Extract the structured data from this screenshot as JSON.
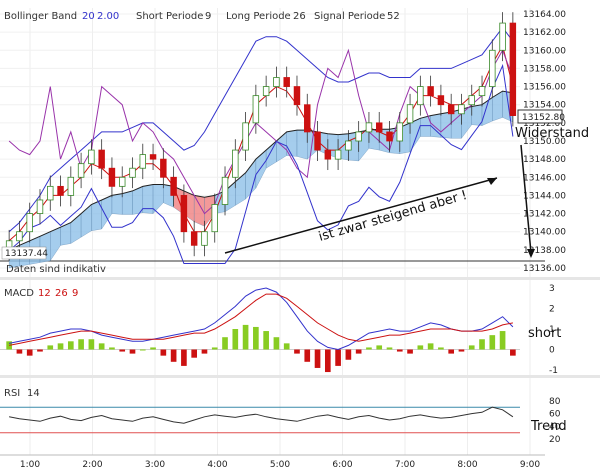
{
  "header": {
    "bb_label": "Bollinger Band",
    "bb_p1": "20",
    "bb_p2": "2.00",
    "short_label": "Short Periode",
    "short_val": "9",
    "long_label": "Long Periode",
    "long_val": "26",
    "signal_label": "Signal Periode",
    "signal_val": "52"
  },
  "price_axis": {
    "ticks": [
      "13164.00",
      "13162.00",
      "13160.00",
      "13158.00",
      "13156.00",
      "13154.00",
      "13152.00",
      "13150.00",
      "13148.00",
      "13146.00",
      "13144.00",
      "13142.00",
      "13140.00",
      "13138.00",
      "13136.00"
    ],
    "current_price": "13152.80",
    "left_price": "13137.44"
  },
  "info_text": "Daten sind indikativ",
  "macd": {
    "label": "MACD",
    "p1": "12",
    "p2": "26",
    "p3": "9",
    "ticks": [
      "3",
      "2",
      "1",
      "0",
      "-1"
    ]
  },
  "rsi": {
    "label": "RSI",
    "period": "14",
    "ticks": [
      "80",
      "60",
      "40",
      "20"
    ]
  },
  "time_ticks": [
    "1:00",
    "2:00",
    "3:00",
    "4:00",
    "5:00",
    "6:00",
    "7:00",
    "8:00",
    "9:00"
  ],
  "annotations": {
    "widerstand": "Widerstand",
    "steigend": "ist zwar steigend aber !",
    "short": "short",
    "trend": "Trend"
  },
  "colors": {
    "bull": "#3a8a2a",
    "bear": "#cc1111",
    "bollinger": "#3333cc",
    "purple": "#9933aa",
    "cloud_blue": "#8fc0e8",
    "cloud_red": "#f08080",
    "macd_pos": "#88cc22",
    "macd_neg": "#cc1111"
  },
  "chart_data": [
    {
      "type": "candlestick",
      "ylim": [
        13136,
        13165
      ],
      "current": 13152.8,
      "start_marker": 13137.44,
      "x": [
        "1:00",
        "2:00",
        "3:00",
        "4:00",
        "5:00",
        "6:00",
        "7:00",
        "8:00",
        "9:00"
      ],
      "close": [
        13139,
        13140,
        13142,
        13143.5,
        13145,
        13144,
        13146,
        13147.5,
        13149,
        13147,
        13145,
        13146,
        13147,
        13148.5,
        13148,
        13146,
        13144,
        13140,
        13138.5,
        13140,
        13143,
        13146,
        13149,
        13152,
        13155,
        13156,
        13157,
        13156,
        13154,
        13151,
        13149,
        13148,
        13149,
        13150,
        13151,
        13152,
        13151,
        13150,
        13152,
        13154,
        13156,
        13155,
        13154,
        13153,
        13154,
        13155,
        13156,
        13160,
        13163,
        13152.8
      ],
      "series": [
        {
          "name": "Bollinger Band",
          "values": [
            13140,
            13141,
            13142.5,
            13144,
            13146,
            13147,
            13148,
            13149,
            13150,
            13151,
            13151,
            13151,
            13151.5,
            13152,
            13152,
            13151,
            13150,
            13149,
            13149.5,
            13151,
            13153,
            13155,
            13157,
            13159,
            13161,
            13161.5,
            13161.5,
            13161,
            13160,
            13159,
            13158,
            13157,
            13156.5,
            13156.5,
            13157,
            13157.5,
            13157.5,
            13157,
            13157,
            13157,
            13158,
            13158,
            13158,
            13158,
            13158.5,
            13159,
            13159.5,
            13161,
            13162.5,
            13161
          ]
        },
        {
          "name": "Short Periode",
          "values": [
            13139,
            13140,
            13141.5,
            13142.5,
            13144,
            13144,
            13145,
            13146,
            13147.5,
            13147,
            13146,
            13146,
            13146.5,
            13147.5,
            13147.5,
            13146.5,
            13145,
            13142,
            13140,
            13140,
            13142,
            13145,
            13148,
            13151,
            13154,
            13155,
            13156,
            13155.5,
            13154,
            13152,
            13150,
            13149,
            13149,
            13150,
            13150.5,
            13151.5,
            13151,
            13150.5,
            13151.5,
            13153,
            13155,
            13155,
            13154.5,
            13154,
            13154,
            13155,
            13156,
            13158.5,
            13160.5,
            13156
          ]
        },
        {
          "name": "Long Periode",
          "values": [
            13138,
            13138.5,
            13139,
            13139.5,
            13140,
            13140.5,
            13141,
            13142,
            13143,
            13143.5,
            13144,
            13144.2,
            13144.5,
            13145,
            13145.2,
            13145.2,
            13145,
            13144.5,
            13144,
            13143.8,
            13144,
            13144.5,
            13145.5,
            13146.5,
            13148,
            13149,
            13150,
            13151,
            13151.2,
            13151.2,
            13151,
            13150.8,
            13150.7,
            13150.8,
            13151,
            13151.2,
            13151.3,
            13151.3,
            13151.5,
            13152,
            13152.5,
            13152.8,
            13153,
            13153.2,
            13153.5,
            13153.8,
            13154,
            13154.8,
            13155.5,
            13155.3
          ]
        },
        {
          "name": "Signal Periode",
          "values": [
            13150,
            13149,
            13148.5,
            13150,
            13156,
            13148,
            13151,
            13147,
            13149,
            13156,
            13155,
            13154,
            13150,
            13152,
            13151,
            13149,
            13148,
            13146,
            13144,
            13142,
            13143,
            13146,
            13148,
            13150,
            13152,
            13151,
            13150,
            13149,
            13147,
            13146,
            13154,
            13158,
            13157,
            13160,
            13155,
            13151,
            13150,
            13149,
            13153,
            13156,
            13155,
            13152,
            13151,
            13152,
            13153,
            13154,
            13155,
            13158,
            13160,
            13157
          ]
        }
      ]
    },
    {
      "type": "bar",
      "name": "MACD",
      "ylim": [
        -1.5,
        3.2
      ],
      "histogram": [
        0.4,
        -0.2,
        -0.3,
        -0.1,
        0.2,
        0.3,
        0.4,
        0.5,
        0.5,
        0.3,
        0.1,
        -0.1,
        -0.2,
        0,
        0.1,
        -0.3,
        -0.6,
        -0.8,
        -0.4,
        -0.2,
        0.1,
        0.6,
        1.0,
        1.2,
        1.1,
        0.9,
        0.6,
        0.3,
        -0.2,
        -0.6,
        -0.9,
        -1.1,
        -0.8,
        -0.5,
        -0.2,
        0.1,
        0.2,
        0.1,
        -0.1,
        -0.2,
        0.2,
        0.3,
        0.1,
        -0.2,
        -0.1,
        0.2,
        0.5,
        0.7,
        0.9,
        -0.3
      ],
      "series": [
        {
          "name": "12",
          "values": [
            0.3,
            0.4,
            0.5,
            0.6,
            0.8,
            0.9,
            1.0,
            1.0,
            0.9,
            0.7,
            0.6,
            0.5,
            0.4,
            0.4,
            0.5,
            0.6,
            0.7,
            0.8,
            0.9,
            1.0,
            1.3,
            1.7,
            2.1,
            2.6,
            2.9,
            3.0,
            2.8,
            2.3,
            1.6,
            0.9,
            0.4,
            0.1,
            0.0,
            0.2,
            0.5,
            0.8,
            0.9,
            1.0,
            0.9,
            0.9,
            1.1,
            1.3,
            1.2,
            1.0,
            0.9,
            0.9,
            1.0,
            1.3,
            1.6,
            1.1
          ]
        },
        {
          "name": "26",
          "values": [
            0.2,
            0.3,
            0.4,
            0.5,
            0.6,
            0.7,
            0.8,
            0.9,
            0.9,
            0.8,
            0.7,
            0.6,
            0.5,
            0.5,
            0.5,
            0.5,
            0.6,
            0.7,
            0.8,
            0.8,
            1.0,
            1.3,
            1.6,
            2.0,
            2.4,
            2.7,
            2.7,
            2.5,
            2.1,
            1.7,
            1.3,
            1.0,
            0.7,
            0.5,
            0.4,
            0.5,
            0.6,
            0.7,
            0.7,
            0.8,
            0.9,
            1.0,
            1.0,
            1.0,
            0.9,
            0.9,
            0.9,
            1.0,
            1.2,
            1.3
          ]
        }
      ]
    },
    {
      "type": "line",
      "name": "RSI",
      "ylim": [
        0,
        100
      ],
      "values": [
        55,
        52,
        50,
        48,
        53,
        56,
        51,
        49,
        54,
        57,
        52,
        50,
        48,
        53,
        55,
        51,
        47,
        45,
        50,
        55,
        58,
        56,
        54,
        57,
        59,
        55,
        52,
        50,
        48,
        52,
        56,
        58,
        54,
        51,
        55,
        57,
        53,
        50,
        52,
        56,
        58,
        55,
        53,
        54,
        57,
        60,
        62,
        70,
        66,
        55
      ]
    }
  ]
}
